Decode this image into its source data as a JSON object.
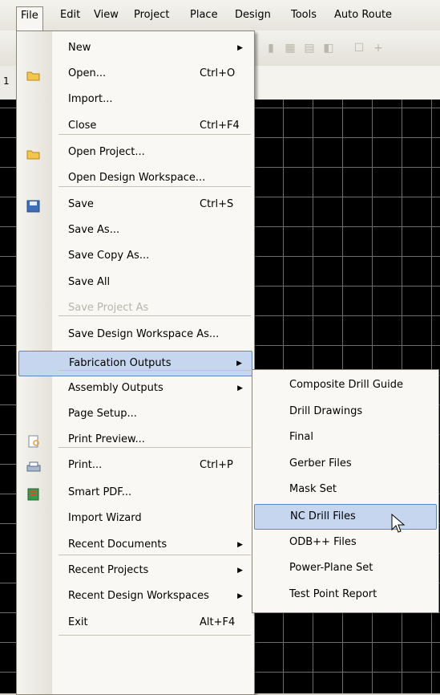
{
  "menubar": {
    "items": [
      "File",
      "Edit",
      "View",
      "Project",
      "Place",
      "Design",
      "Tools",
      "Auto Route"
    ]
  },
  "ruler": {
    "number": "1"
  },
  "file_menu": {
    "items": [
      {
        "label": "New",
        "shortcut": "",
        "submenu": true,
        "icon": ""
      },
      {
        "label": "Open...",
        "shortcut": "Ctrl+O",
        "submenu": false,
        "icon": "open-folder-icon"
      },
      {
        "label": "Import...",
        "shortcut": "",
        "submenu": false,
        "icon": ""
      },
      {
        "label": "Close",
        "shortcut": "Ctrl+F4",
        "submenu": false,
        "icon": ""
      },
      {
        "label": "Open Project...",
        "shortcut": "",
        "submenu": false,
        "icon": "open-project-icon"
      },
      {
        "label": "Open Design Workspace...",
        "shortcut": "",
        "submenu": false,
        "icon": ""
      },
      {
        "label": "Save",
        "shortcut": "Ctrl+S",
        "submenu": false,
        "icon": "save-disk-icon"
      },
      {
        "label": "Save As...",
        "shortcut": "",
        "submenu": false,
        "icon": ""
      },
      {
        "label": "Save Copy As...",
        "shortcut": "",
        "submenu": false,
        "icon": ""
      },
      {
        "label": "Save All",
        "shortcut": "",
        "submenu": false,
        "icon": ""
      },
      {
        "label": "Save Project As",
        "shortcut": "",
        "submenu": false,
        "icon": "",
        "disabled": true
      },
      {
        "label": "Save Design Workspace As...",
        "shortcut": "",
        "submenu": false,
        "icon": ""
      },
      {
        "label": "Fabrication Outputs",
        "shortcut": "",
        "submenu": true,
        "icon": "",
        "highlighted": true
      },
      {
        "label": "Assembly Outputs",
        "shortcut": "",
        "submenu": true,
        "icon": ""
      },
      {
        "label": "Page Setup...",
        "shortcut": "",
        "submenu": false,
        "icon": ""
      },
      {
        "label": "Print Preview...",
        "shortcut": "",
        "submenu": false,
        "icon": "print-preview-icon"
      },
      {
        "label": "Print...",
        "shortcut": "Ctrl+P",
        "submenu": false,
        "icon": "printer-icon"
      },
      {
        "label": "Smart PDF...",
        "shortcut": "",
        "submenu": false,
        "icon": "smart-pdf-icon"
      },
      {
        "label": "Import Wizard",
        "shortcut": "",
        "submenu": false,
        "icon": ""
      },
      {
        "label": "Recent Documents",
        "shortcut": "",
        "submenu": true,
        "icon": ""
      },
      {
        "label": "Recent Projects",
        "shortcut": "",
        "submenu": true,
        "icon": ""
      },
      {
        "label": "Recent Design Workspaces",
        "shortcut": "",
        "submenu": true,
        "icon": ""
      },
      {
        "label": "Exit",
        "shortcut": "Alt+F4",
        "submenu": false,
        "icon": ""
      }
    ]
  },
  "fabrication_submenu": {
    "items": [
      {
        "label": "Composite Drill Guide"
      },
      {
        "label": "Drill Drawings"
      },
      {
        "label": "Final"
      },
      {
        "label": "Gerber Files"
      },
      {
        "label": "Mask Set"
      },
      {
        "label": "NC Drill Files",
        "highlighted": true
      },
      {
        "label": "ODB++ Files"
      },
      {
        "label": "Power-Plane Set"
      },
      {
        "label": "Test Point Report"
      }
    ]
  },
  "colors": {
    "highlight_bg": "#c6d6ee",
    "highlight_border": "#5f87c6",
    "canvas": "#000000",
    "grid": "#6d6d6d"
  }
}
